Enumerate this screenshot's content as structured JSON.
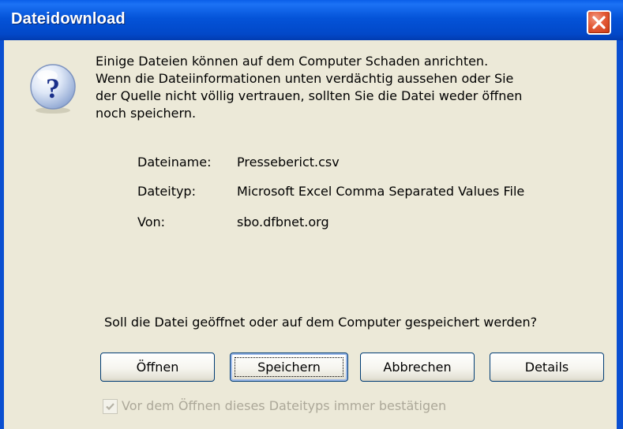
{
  "window": {
    "title": "Dateidownload"
  },
  "icons": {
    "dialog_icon": "question-icon",
    "close_icon": "close-icon"
  },
  "message": {
    "lines": [
      "Einige Dateien können auf dem Computer Schaden anrichten.",
      "Wenn die Dateiinformationen unten verdächtig aussehen oder Sie",
      "der Quelle nicht völlig vertrauen, sollten Sie die Datei weder öffnen",
      "noch speichern."
    ]
  },
  "file_info": {
    "name_label": "Dateiname:",
    "name_value": "Presseberict.csv",
    "type_label": "Dateityp:",
    "type_value": "Microsoft Excel Comma Separated Values File",
    "from_label": "Von:",
    "from_value": "sbo.dfbnet.org"
  },
  "question": "Soll die Datei geöffnet oder auf dem Computer gespeichert werden?",
  "buttons": {
    "open": "Öffnen",
    "save": "Speichern",
    "cancel": "Abbrechen",
    "details": "Details"
  },
  "checkbox": {
    "label": "Vor dem Öffnen dieses Dateityps immer bestätigen",
    "checked": true,
    "enabled": false
  },
  "colors": {
    "title_bar": "#0453d8",
    "dialog_bg": "#ece9d8",
    "close_button": "#e35a36",
    "disabled_text": "#aca899"
  }
}
